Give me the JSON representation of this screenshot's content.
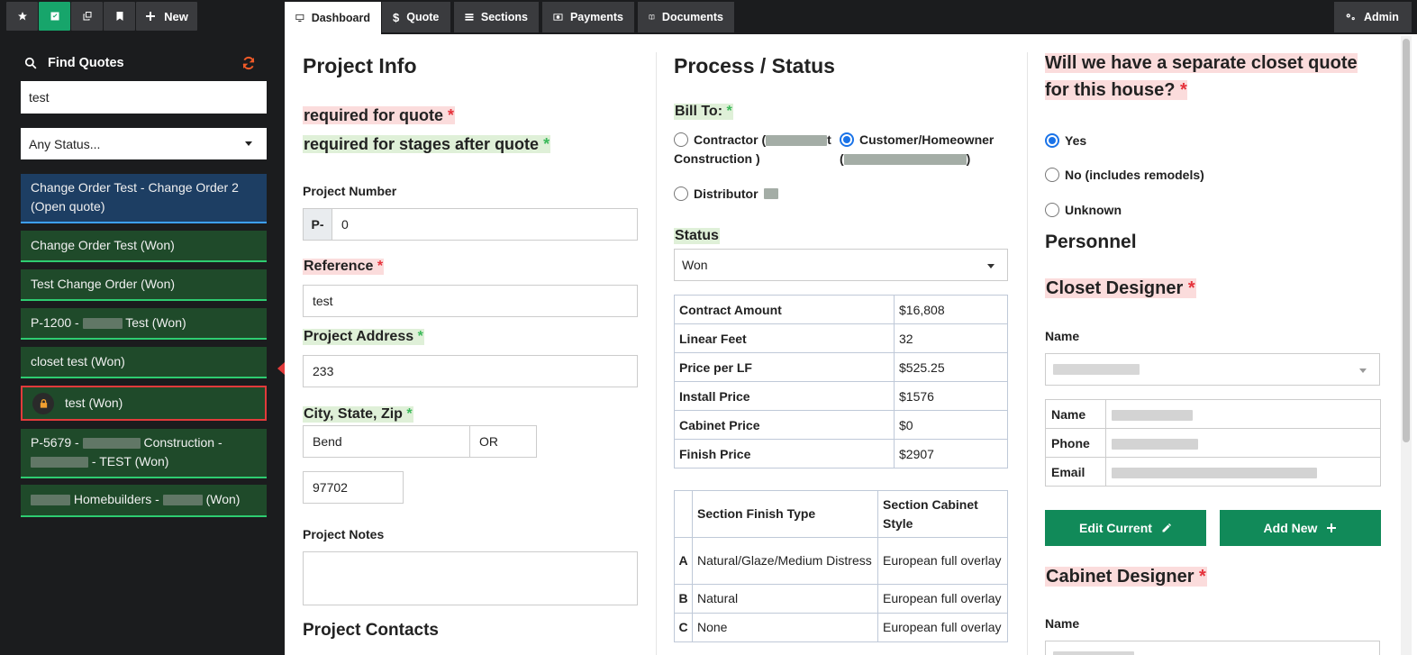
{
  "toolbar": {
    "new_label": "New",
    "admin_label": "Admin"
  },
  "tabs": [
    {
      "label": "Dashboard",
      "icon": "monitor-icon"
    },
    {
      "label": "Quote",
      "icon": "dollar-icon"
    },
    {
      "label": "Sections",
      "icon": "list-icon"
    },
    {
      "label": "Payments",
      "icon": "money-icon"
    },
    {
      "label": "Documents",
      "icon": "book-icon"
    }
  ],
  "sidebar": {
    "title": "Find Quotes",
    "search_value": "test",
    "status_value": "Any Status...",
    "quotes": [
      {
        "line1": "Change Order Test - Change Order 2",
        "line2": "(Open quote)"
      },
      {
        "text": "Change Order Test (Won)"
      },
      {
        "text": "Test Change Order (Won)"
      },
      {
        "prefix": "P-1200 -",
        "suffix": "Test (Won)"
      },
      {
        "text": "closet test (Won)"
      },
      {
        "text": "test (Won)"
      },
      {
        "prefix": "P-5679 -",
        "mid": "Construction -",
        "suffix": "- TEST (Won)"
      },
      {
        "mid": "Homebuilders -",
        "suffix": "(Won)"
      }
    ]
  },
  "project_info": {
    "title": "Project Info",
    "req_quote": "required for quote",
    "req_stages": "required for stages after quote",
    "project_number_label": "Project Number",
    "project_number_prefix": "P-",
    "project_number_value": "0",
    "reference_label": "Reference",
    "reference_value": "test",
    "address_label": "Project Address",
    "address_value": "233",
    "csz_label": "City, State, Zip",
    "city": "Bend",
    "state": "OR",
    "zip": "97702",
    "notes_label": "Project Notes",
    "contacts_title": "Project Contacts"
  },
  "process": {
    "title": "Process / Status",
    "bill_to_label": "Bill To:",
    "contractor_label": "Contractor (",
    "contractor_tail": "t",
    "contractor_line2": "Construction )",
    "customer_label": "Customer/Homeowner",
    "customer_open": "(",
    "customer_close": ")",
    "distributor_label": "Distributor",
    "status_label": "Status",
    "status_value": "Won",
    "amounts": [
      {
        "k": "Contract Amount",
        "v": "$16,808"
      },
      {
        "k": "Linear Feet",
        "v": "32"
      },
      {
        "k": "Price per LF",
        "v": "$525.25"
      },
      {
        "k": "Install Price",
        "v": "$1576"
      },
      {
        "k": "Cabinet Price",
        "v": "$0"
      },
      {
        "k": "Finish Price",
        "v": "$2907"
      }
    ],
    "sections_header": {
      "finish": "Section Finish Type",
      "cabinet": "Section Cabinet Style"
    },
    "sections": [
      {
        "letter": "A",
        "finish": "Natural/Glaze/Medium Distress",
        "cabinet": "European full overlay"
      },
      {
        "letter": "B",
        "finish": "Natural",
        "cabinet": "European full overlay"
      },
      {
        "letter": "C",
        "finish": "None",
        "cabinet": "European full overlay"
      }
    ]
  },
  "right": {
    "closet_question": "Will we have a separate closet quote for this house?",
    "options": [
      "Yes",
      "No (includes remodels)",
      "Unknown"
    ],
    "personnel_title": "Personnel",
    "closet_designer_title": "Closet Designer",
    "name_label": "Name",
    "table_labels": {
      "name": "Name",
      "phone": "Phone",
      "email": "Email"
    },
    "edit_label": "Edit Current",
    "add_label": "Add New",
    "cabinet_designer_title": "Cabinet Designer",
    "cabinet_name_label": "Name"
  },
  "colors": {
    "accent_green": "#17a56b",
    "required_red": "#e5323b",
    "required_green": "#3cb95a",
    "sidebar_bg": "#1b1c1e"
  }
}
